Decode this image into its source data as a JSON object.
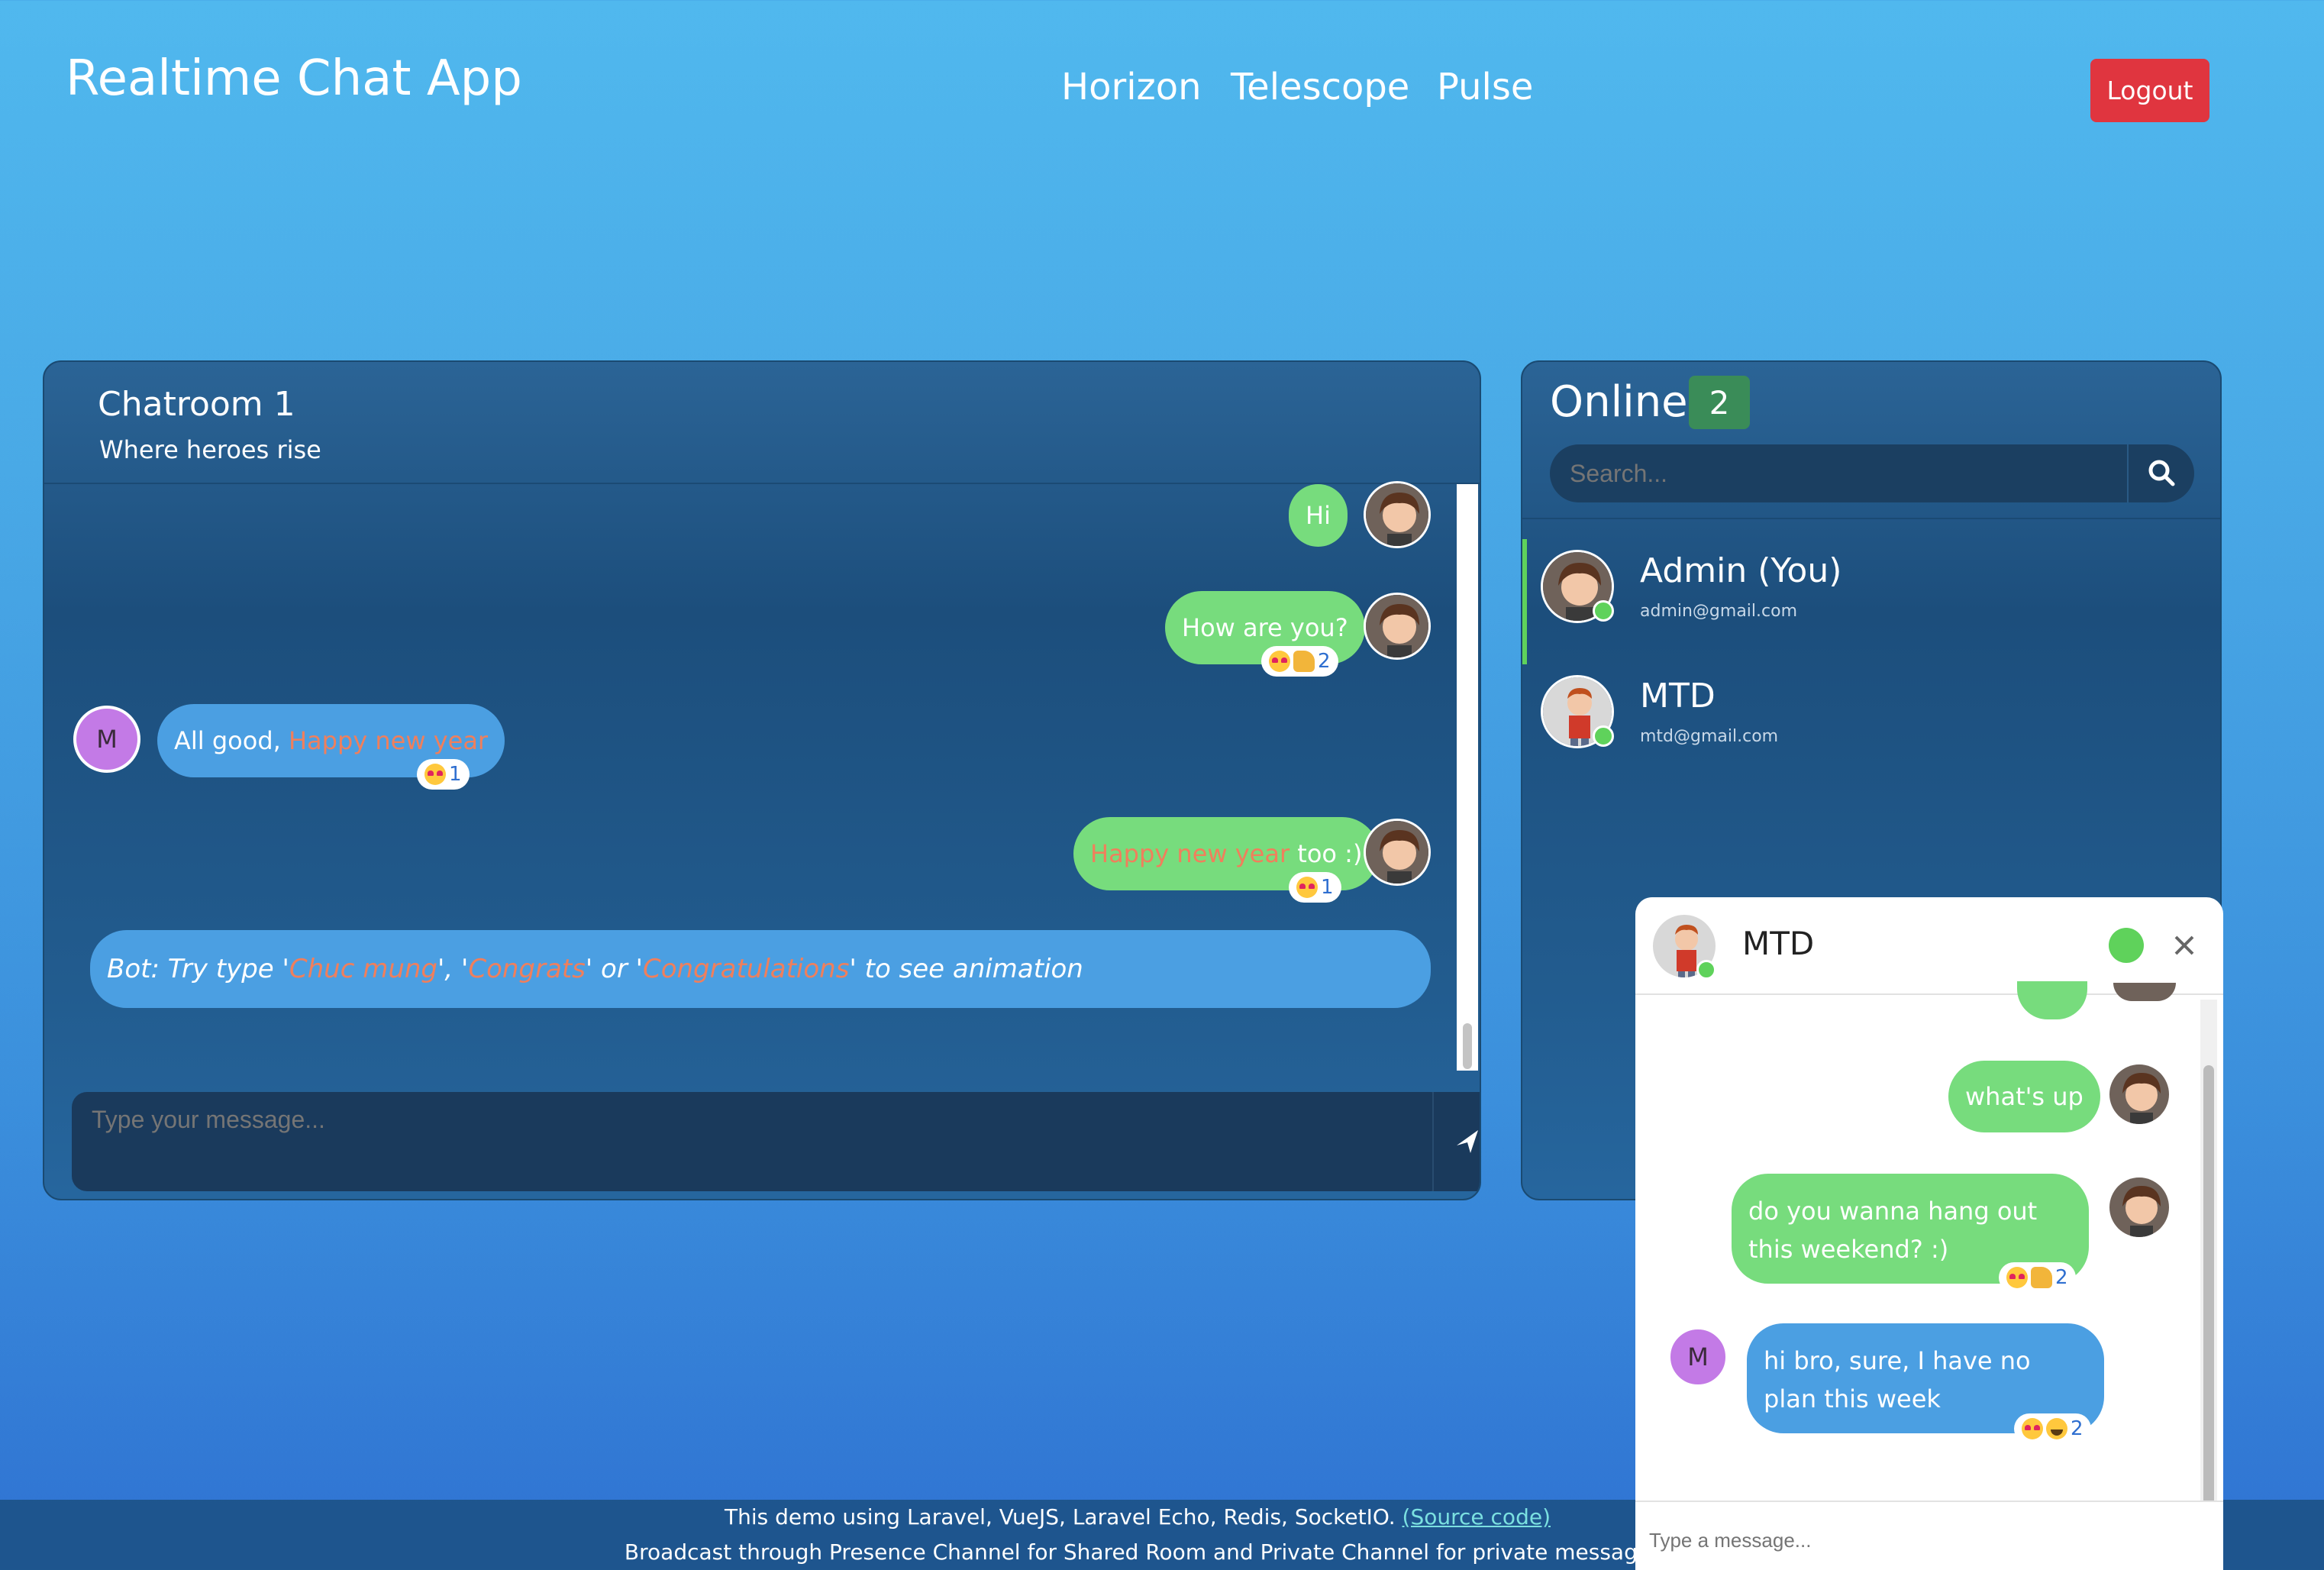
{
  "header": {
    "brand": "Realtime Chat App",
    "nav": [
      "Horizon",
      "Telescope",
      "Pulse"
    ],
    "logout": "Logout"
  },
  "chatroom": {
    "title": "Chatroom 1",
    "subtitle": "Where heroes rise",
    "messages": [
      {
        "text": "Hi"
      },
      {
        "text": "How are you?",
        "reaction_count": "2"
      },
      {
        "avatar_letter": "M",
        "text_prefix": "All good, ",
        "text_highlight": "Happy new year",
        "reaction_count": "1"
      },
      {
        "text_highlight": "Happy new year",
        "text_suffix": " too :)",
        "reaction_count": "1"
      }
    ],
    "bot": {
      "p1": "Bot: Try type '",
      "h1": "Chuc mung",
      "p2": "', '",
      "h2": "Congrats",
      "p3": "' or '",
      "h3": "Congratulations",
      "p4": "' to see animation"
    },
    "input_placeholder": "Type your message..."
  },
  "online": {
    "title": "Online",
    "count": "2",
    "search_placeholder": "Search...",
    "users": [
      {
        "name": "Admin (You)",
        "email": "admin@gmail.com"
      },
      {
        "name": "MTD",
        "email": "mtd@gmail.com"
      }
    ]
  },
  "private_chat": {
    "name": "MTD",
    "messages": [
      {
        "text": "what's up"
      },
      {
        "text": "do you wanna hang out this weekend? :)",
        "reaction_count": "2"
      },
      {
        "avatar_letter": "M",
        "text": "hi bro, sure, I have no plan this week",
        "reaction_count": "2"
      }
    ],
    "input_placeholder": "Type a message..."
  },
  "footer": {
    "line1": "This demo using Laravel, VueJS, Laravel Echo, Redis, SocketIO.",
    "source_link": "(Source code)",
    "line2": "Broadcast through Presence Channel for Shared Room and Private Channel for private message"
  },
  "colors": {
    "green_bubble": "#77dc7d",
    "blue_bubble": "#4b9fe2",
    "highlight": "#f07f5c",
    "logout": "#e0353f",
    "online_badge": "#3a8c58",
    "status_green": "#5fd25b",
    "m_avatar": "#c37ae6"
  }
}
